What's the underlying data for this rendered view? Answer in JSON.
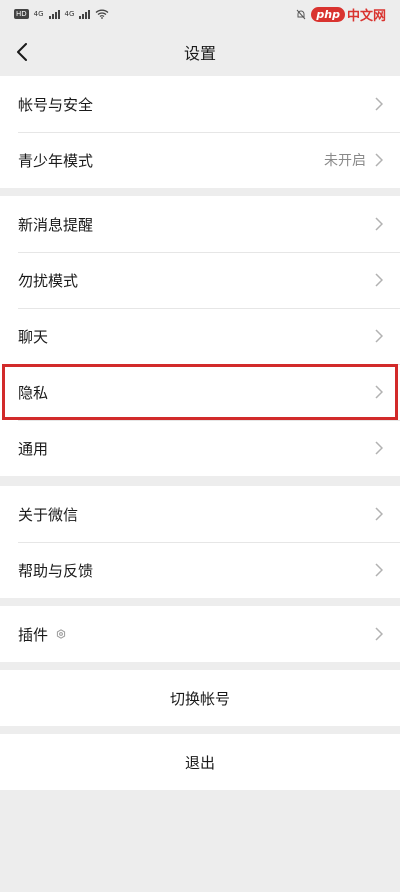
{
  "status_bar": {
    "hd_label": "HD",
    "signal_label_1": "4G",
    "signal_label_2": "4G",
    "watermark_logo": "php",
    "watermark_text": "中文网"
  },
  "nav": {
    "title": "设置"
  },
  "groups": [
    {
      "items": [
        {
          "label": "帐号与安全",
          "value": ""
        },
        {
          "label": "青少年模式",
          "value": "未开启"
        }
      ]
    },
    {
      "items": [
        {
          "label": "新消息提醒",
          "value": ""
        },
        {
          "label": "勿扰模式",
          "value": ""
        },
        {
          "label": "聊天",
          "value": ""
        },
        {
          "label": "隐私",
          "value": "",
          "highlighted": true
        },
        {
          "label": "通用",
          "value": ""
        }
      ]
    },
    {
      "items": [
        {
          "label": "关于微信",
          "value": ""
        },
        {
          "label": "帮助与反馈",
          "value": ""
        }
      ]
    },
    {
      "items": [
        {
          "label": "插件",
          "value": ""
        }
      ]
    }
  ],
  "actions": {
    "switch_account": "切换帐号",
    "logout": "退出"
  },
  "colors": {
    "background": "#ededed",
    "highlight": "#d22a2a",
    "secondary_text": "#8a8a8a"
  }
}
